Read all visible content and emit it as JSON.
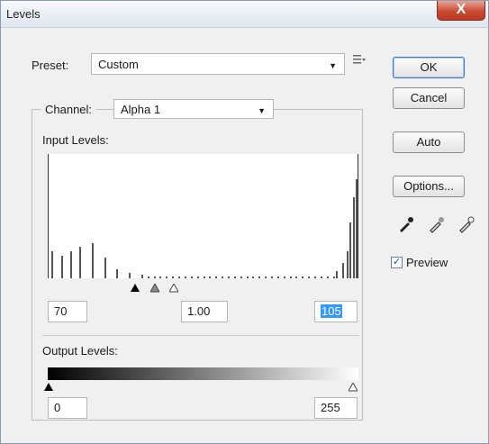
{
  "window": {
    "title": "Levels",
    "close_label": "X"
  },
  "preset": {
    "label": "Preset:",
    "value": "Custom",
    "menu_icon": "list-icon"
  },
  "channel": {
    "label": "Channel:",
    "value": "Alpha 1"
  },
  "input_levels": {
    "label": "Input Levels:",
    "black": "70",
    "gamma": "1.00",
    "white": "105"
  },
  "output_levels": {
    "label": "Output Levels:",
    "black": "0",
    "white": "255"
  },
  "buttons": {
    "ok": "OK",
    "cancel": "Cancel",
    "auto": "Auto",
    "options": "Options..."
  },
  "preview": {
    "label": "Preview",
    "checked": true
  },
  "colors": {
    "accent": "#3399ff",
    "close": "#c94a33"
  },
  "histogram": {
    "bars": [
      {
        "pos": 0.01,
        "height": 0.22
      },
      {
        "pos": 0.04,
        "height": 0.18
      },
      {
        "pos": 0.07,
        "height": 0.22
      },
      {
        "pos": 0.1,
        "height": 0.25
      },
      {
        "pos": 0.14,
        "height": 0.28
      },
      {
        "pos": 0.18,
        "height": 0.17
      },
      {
        "pos": 0.22,
        "height": 0.07
      },
      {
        "pos": 0.26,
        "height": 0.04
      },
      {
        "pos": 0.3,
        "height": 0.03
      },
      {
        "pos": 0.93,
        "height": 0.06
      },
      {
        "pos": 0.95,
        "height": 0.12
      },
      {
        "pos": 0.965,
        "height": 0.22
      },
      {
        "pos": 0.975,
        "height": 0.45
      },
      {
        "pos": 0.985,
        "height": 0.65
      },
      {
        "pos": 0.995,
        "height": 0.8
      }
    ]
  }
}
